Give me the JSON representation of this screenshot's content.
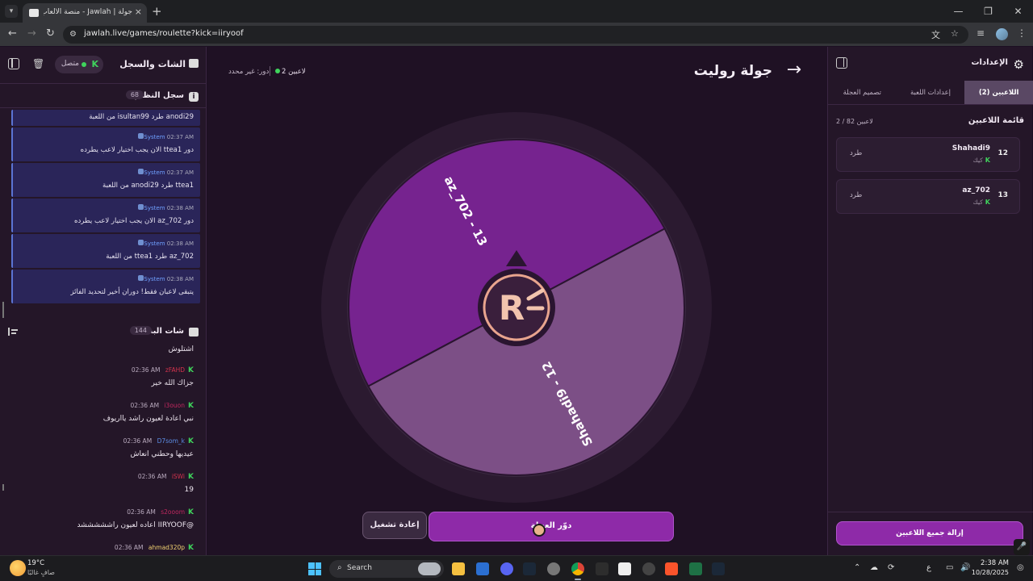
{
  "browser": {
    "tab_title": "جولة | Jawlah - منصة الألعاب الت...",
    "url": "jawlah.live/games/roulette?kick=iiryoof"
  },
  "left_panel": {
    "title": "الشات والسجل",
    "connection_status": "متصل",
    "k_badge": "K",
    "system_log": {
      "title": "سجل النظام",
      "count": "68",
      "entries": [
        {
          "time": "",
          "sender": "",
          "message": "anodi29 طرد isultan99 من اللعبة"
        },
        {
          "time": "02:37 AM",
          "sender": "System",
          "message": "دور ttea1 الان يجب اختيار لاعب يطرده"
        },
        {
          "time": "02:37 AM",
          "sender": "System",
          "message": "ttea1 طرد anodi29 من اللعبة"
        },
        {
          "time": "02:38 AM",
          "sender": "System",
          "message": "دور az_702 الان يجب اختيار لاعب يطرده"
        },
        {
          "time": "02:38 AM",
          "sender": "System",
          "message": "az_702 طرد ttea1 من اللعبة"
        },
        {
          "time": "02:38 AM",
          "sender": "System",
          "message": "يتبقى لاعبان فقط! دوران أخير لتحديد الفائز"
        }
      ]
    },
    "live_chat": {
      "title": "شات البث",
      "count": "144",
      "messages": [
        {
          "time": "",
          "user": "",
          "user_color": "",
          "text": "اشتلوش"
        },
        {
          "time": "02:36 AM",
          "user": "zFAHD",
          "user_color": "#d2334d",
          "text": "جزاك الله خير"
        },
        {
          "time": "02:36 AM",
          "user": "i3ouon",
          "user_color": "#c0285f",
          "text": "نبي اعادة لعيون راشد يااريوف"
        },
        {
          "time": "02:36 AM",
          "user": "D7som_k",
          "user_color": "#5c8ee6",
          "text": "عيديها وحطني انعاش"
        },
        {
          "time": "02:36 AM",
          "user": "iSWi",
          "user_color": "#d2334d",
          "text": "19"
        },
        {
          "time": "02:36 AM",
          "user": "s2ooom",
          "user_color": "#c0285f",
          "text": "@IIRYOOF اعاده لعيون راشششششد"
        },
        {
          "time": "02:36 AM",
          "user": "ahmad320p",
          "user_color": "#f0d070",
          "text": ""
        }
      ]
    }
  },
  "main": {
    "title": "جولة روليت",
    "players_stat": "2 لاعبين",
    "turn_stat": "دور: غير محدد",
    "restart_label": "إعادة تشغيل",
    "spin_label": "دوّر العجلة",
    "logo_text": "R"
  },
  "wheel": {
    "segments": [
      {
        "label": "az_702 - 13",
        "color": "#76238f"
      },
      {
        "label": "Shahadi9 - 12",
        "color": "#7c4f86"
      }
    ]
  },
  "right_panel": {
    "title": "الإعدادات",
    "tabs": [
      "اللاعبين (2)",
      "إعدادات اللعبة",
      "تصميم العجلة"
    ],
    "player_list_title": "قائمة اللاعبين",
    "player_count": "2 / 82 لاعبين",
    "players": [
      {
        "number": "12",
        "name": "Shahadi9",
        "platform": "كيك",
        "kick_label": "طرد"
      },
      {
        "number": "13",
        "name": "az_702",
        "platform": "كيك",
        "kick_label": "طرد"
      }
    ],
    "remove_all_label": "إزالة جميع اللاعبين"
  },
  "taskbar": {
    "weather_temp": "19°C",
    "weather_desc": "صافٍ غالبًا",
    "search_label": "Search",
    "lang": "ع",
    "time": "2:38 AM",
    "date": "10/28/2025"
  }
}
